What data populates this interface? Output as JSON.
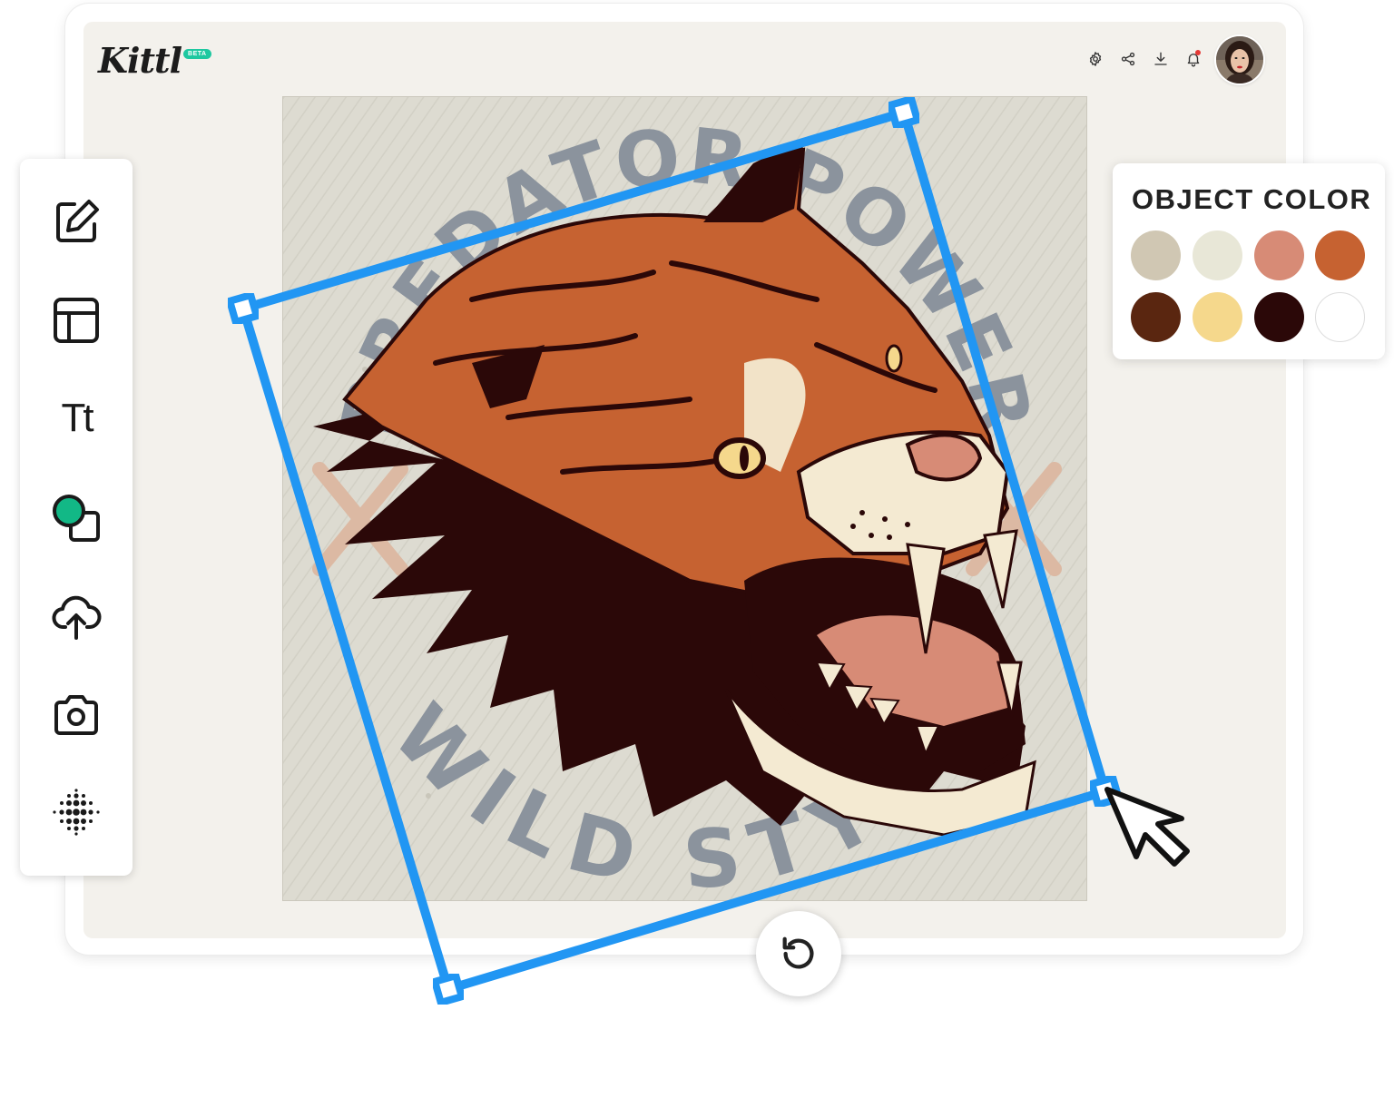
{
  "app": {
    "logo": "Kittl",
    "badge": "BETA"
  },
  "header": {
    "icons": [
      "settings-icon",
      "share-icon",
      "download-icon",
      "notification-icon"
    ],
    "notification_dot_color": "#e53935",
    "avatar": "user-avatar"
  },
  "toolbar": {
    "tools": [
      {
        "name": "edit-tool",
        "icon": "edit-icon"
      },
      {
        "name": "templates-tool",
        "icon": "layout-icon"
      },
      {
        "name": "text-tool",
        "icon": "text-icon",
        "label": "Tt"
      },
      {
        "name": "elements-tool",
        "icon": "shapes-icon"
      },
      {
        "name": "upload-tool",
        "icon": "upload-cloud-icon"
      },
      {
        "name": "photos-tool",
        "icon": "camera-icon"
      },
      {
        "name": "halftone-tool",
        "icon": "halftone-icon"
      }
    ],
    "accent_color": "#12b886"
  },
  "canvas": {
    "design_text_top": "PREDATOR POWER",
    "design_text_bottom": "WILD STYLE",
    "selection_color": "#2196f3"
  },
  "color_panel": {
    "title": "OBJECT COLOR",
    "colors": [
      "#d0c7b3",
      "#e8e7d7",
      "#d78b76",
      "#c66231",
      "#5a2610",
      "#f5d88c",
      "#2b0808",
      "#ffffff"
    ]
  },
  "controls": {
    "rotate_icon": "rotate-icon"
  }
}
